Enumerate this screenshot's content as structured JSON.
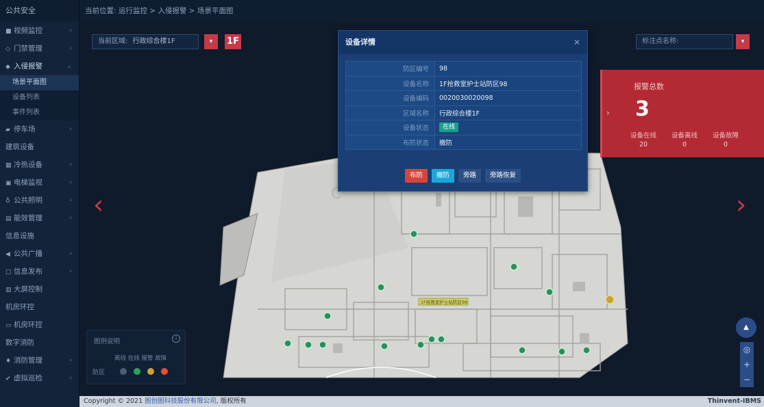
{
  "sidebar": {
    "header": "公共安全",
    "items": [
      {
        "label": "视频监控",
        "icon": "video-icon",
        "arrow": "‹"
      },
      {
        "label": "门禁管理",
        "icon": "door-icon",
        "arrow": "‹"
      },
      {
        "label": "入侵报警",
        "icon": "shield-icon",
        "arrow": "⌄",
        "active": true
      },
      {
        "label": "停车场",
        "icon": "car-icon",
        "arrow": "‹"
      },
      {
        "label": "建筑设备",
        "icon": "",
        "arrow": ""
      },
      {
        "label": "冷热设备",
        "icon": "grid-icon",
        "arrow": "‹"
      },
      {
        "label": "电梯监视",
        "icon": "elevator-icon",
        "arrow": "‹"
      },
      {
        "label": "公共照明",
        "icon": "light-icon",
        "arrow": "‹"
      },
      {
        "label": "能效管理",
        "icon": "meter-icon",
        "arrow": "‹"
      },
      {
        "label": "信息设施",
        "icon": "",
        "arrow": ""
      },
      {
        "label": "公共广播",
        "icon": "speaker-icon",
        "arrow": "‹"
      },
      {
        "label": "信息发布",
        "icon": "monitor-icon",
        "arrow": "‹"
      },
      {
        "label": "大屏控制",
        "icon": "screen-icon",
        "arrow": ""
      },
      {
        "label": "机房环控",
        "icon": "",
        "arrow": ""
      },
      {
        "label": "机房环控",
        "icon": "server-icon",
        "arrow": ""
      },
      {
        "label": "数字消防",
        "icon": "",
        "arrow": ""
      },
      {
        "label": "消防管理",
        "icon": "fire-icon",
        "arrow": "‹"
      },
      {
        "label": "虚拟巡检",
        "icon": "check-icon",
        "arrow": "‹"
      }
    ],
    "sub_items": [
      "场景平面图",
      "设备列表",
      "事件列表"
    ]
  },
  "breadcrumb": "当前位置: 运行监控 > 入侵报警 > 场景平面图",
  "region": {
    "label": "当前区域:",
    "value": "行政综合楼1F",
    "floor": "1F"
  },
  "mark_search": {
    "placeholder": "标注点名称:"
  },
  "alarm": {
    "title": "报警总数",
    "total": "3",
    "stats": [
      {
        "label": "设备在线",
        "value": "20"
      },
      {
        "label": "设备离线",
        "value": "0"
      },
      {
        "label": "设备故障",
        "value": "0"
      }
    ]
  },
  "map": {
    "tooltip": "1F抢救室护士站防区98"
  },
  "legend": {
    "title": "图例说明",
    "columns": "离线 在线 报警 故障",
    "row_label": "防区",
    "colors": [
      "#4c5d77",
      "#2aa55b",
      "#c9a238",
      "#e0522f"
    ]
  },
  "modal": {
    "title": "设备详情",
    "rows": [
      {
        "key": "防区编号",
        "value": "98"
      },
      {
        "key": "设备名称",
        "value": "1F抢救室护士站防区98"
      },
      {
        "key": "设备编码",
        "value": "0020030020098"
      },
      {
        "key": "区域名称",
        "value": "行政综合楼1F"
      },
      {
        "key": "设备状态",
        "value": "在线"
      },
      {
        "key": "布防状态",
        "value": "撤防"
      }
    ],
    "buttons": {
      "arm": "布防",
      "disarm": "撤防",
      "bypass": "旁路",
      "bypass_restore": "旁路恢复"
    }
  },
  "footer": {
    "copyright_prefix": "Copyright © 2021",
    "company": "图创图科技股份有限公司",
    "rights": "版权所有",
    "brand": "Thinvent-IBMS"
  }
}
